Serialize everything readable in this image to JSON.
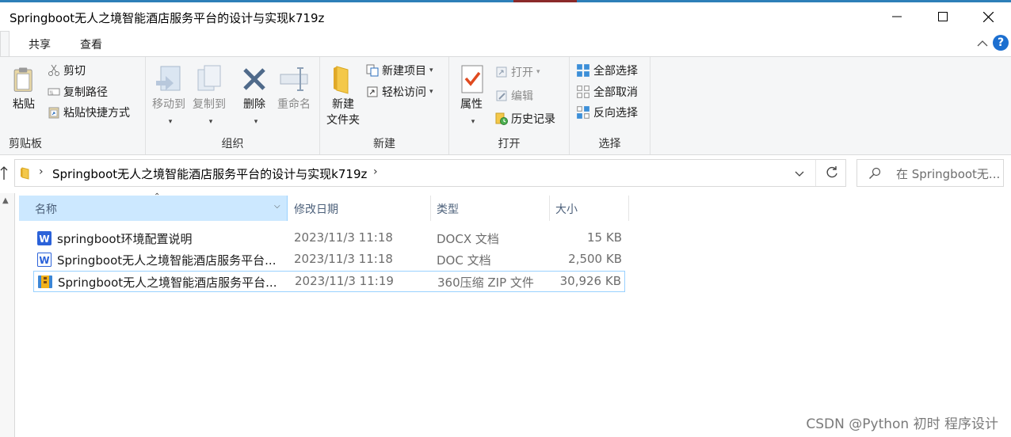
{
  "window": {
    "title": "Springboot无人之境智能酒店服务平台的设计与实现k719z",
    "minimize_icon": "minimize-icon",
    "maximize_icon": "maximize-icon",
    "close_icon": "close-icon"
  },
  "tabs": [
    {
      "label": "共享"
    },
    {
      "label": "查看"
    }
  ],
  "ribbon": {
    "clipboard": {
      "label": "剪贴板",
      "paste": "粘贴",
      "cut": "剪切",
      "copy_path": "复制路径",
      "paste_shortcut": "粘贴快捷方式"
    },
    "organize": {
      "label": "组织",
      "move_to": "移动到",
      "copy_to": "复制到",
      "delete": "删除",
      "rename": "重命名"
    },
    "new": {
      "label": "新建",
      "new_folder_line1": "新建",
      "new_folder_line2": "文件夹",
      "new_item": "新建项目",
      "easy_access": "轻松访问"
    },
    "open": {
      "label": "打开",
      "properties": "属性",
      "open": "打开",
      "edit": "编辑",
      "history": "历史记录"
    },
    "select": {
      "label": "选择",
      "select_all": "全部选择",
      "select_none": "全部取消",
      "invert": "反向选择"
    }
  },
  "address": {
    "path": "Springboot无人之境智能酒店服务平台的设计与实现k719z",
    "search_placeholder": "在 Springboot无..."
  },
  "columns": {
    "name": "名称",
    "date": "修改日期",
    "type": "类型",
    "size": "大小"
  },
  "files": [
    {
      "name": "springboot环境配置说明",
      "date": "2023/11/3 11:18",
      "type": "DOCX 文档",
      "size": "15 KB",
      "icon": "word-icon"
    },
    {
      "name": "Springboot无人之境智能酒店服务平台...",
      "date": "2023/11/3 11:18",
      "type": "DOC 文档",
      "size": "2,500 KB",
      "icon": "word-icon"
    },
    {
      "name": "Springboot无人之境智能酒店服务平台...",
      "date": "2023/11/3 11:19",
      "type": "360压缩 ZIP 文件",
      "size": "30,926 KB",
      "icon": "zip-icon"
    }
  ],
  "watermark": "CSDN @Python 初时 程序设计",
  "colors": {
    "accent": "#1c6fd0",
    "selection": "#cce8ff",
    "selection_border": "#99d1ff"
  }
}
